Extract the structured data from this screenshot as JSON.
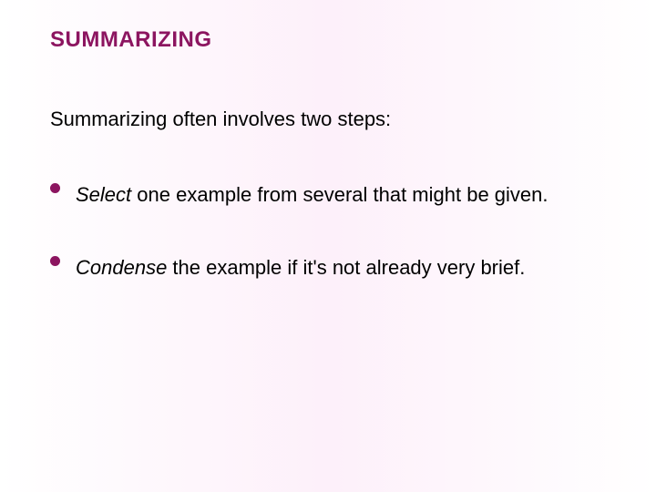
{
  "title": "SUMMARIZING",
  "intro": "Summarizing often involves two steps:",
  "bullets": [
    {
      "lead": "Select",
      "rest": " one example from several that might be given."
    },
    {
      "lead": "Condense",
      "rest": " the example if it's not already very brief."
    }
  ]
}
